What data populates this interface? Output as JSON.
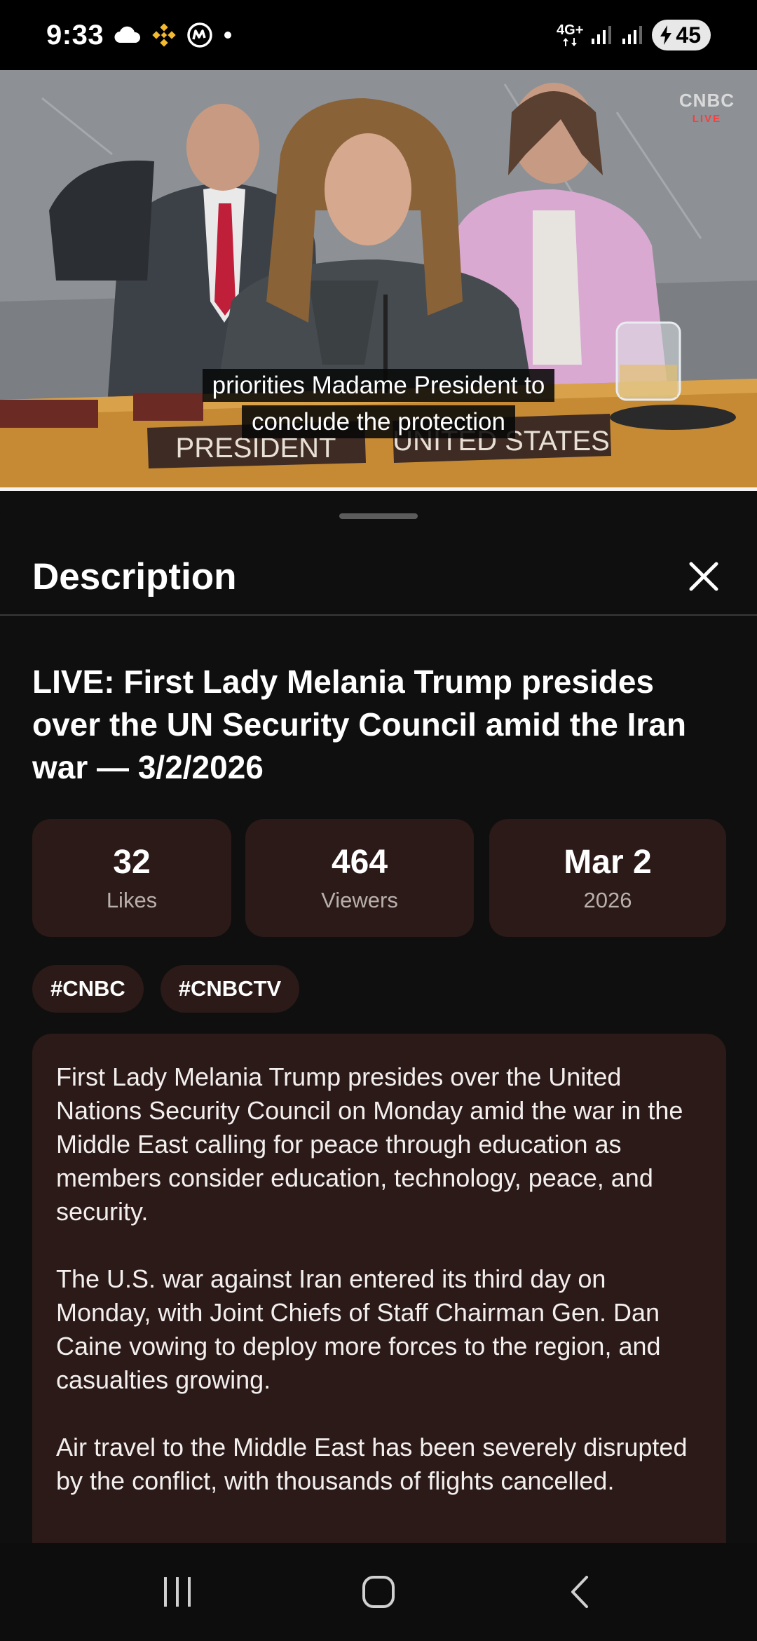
{
  "status_bar": {
    "time": "9:33",
    "network_label": "4G+",
    "battery_level": "45",
    "icons": [
      "cloud-icon",
      "binance-icon",
      "coinmarketcap-icon",
      "dot-icon",
      "signal-icon",
      "signal-icon",
      "battery-charging-icon"
    ]
  },
  "video": {
    "channel_logo": "CNBC",
    "live_badge": "LIVE",
    "caption_line1": "priorities Madame President to",
    "caption_line2": "conclude the protection",
    "nameplate_left": "PRESIDENT",
    "nameplate_right": "UNITED STATES",
    "progress": 1.0
  },
  "sheet": {
    "title": "Description",
    "close_icon": "close-icon"
  },
  "video_info": {
    "title": "LIVE: First Lady Melania Trump presides over the UN Security Council amid the Iran war — 3/2/2026",
    "stats": [
      {
        "value": "32",
        "label": "Likes"
      },
      {
        "value": "464",
        "label": "Viewers"
      },
      {
        "value": "Mar 2",
        "label": "2026"
      }
    ],
    "tags": [
      "#CNBC",
      "#CNBCTV"
    ],
    "description": [
      "First Lady Melania Trump presides over the United Nations Security Council on Monday amid the war in the Middle East calling for peace through education as members consider education, technology, peace, and security.",
      "The U.S. war against Iran entered its third day on Monday, with Joint Chiefs of Staff Chairman Gen. Dan Caine vowing to deploy more forces to the region, and casualties growing.",
      "Air travel to the Middle East has been severely disrupted by the conflict, with thousands of flights cancelled."
    ]
  },
  "nav_bar": {
    "icons": [
      "recent-apps-icon",
      "home-icon",
      "back-icon"
    ]
  },
  "colors": {
    "background": "#0f0f0f",
    "card": "#2b1a17",
    "muted_text": "#b9b0ad",
    "divider": "#3a3a3a"
  }
}
